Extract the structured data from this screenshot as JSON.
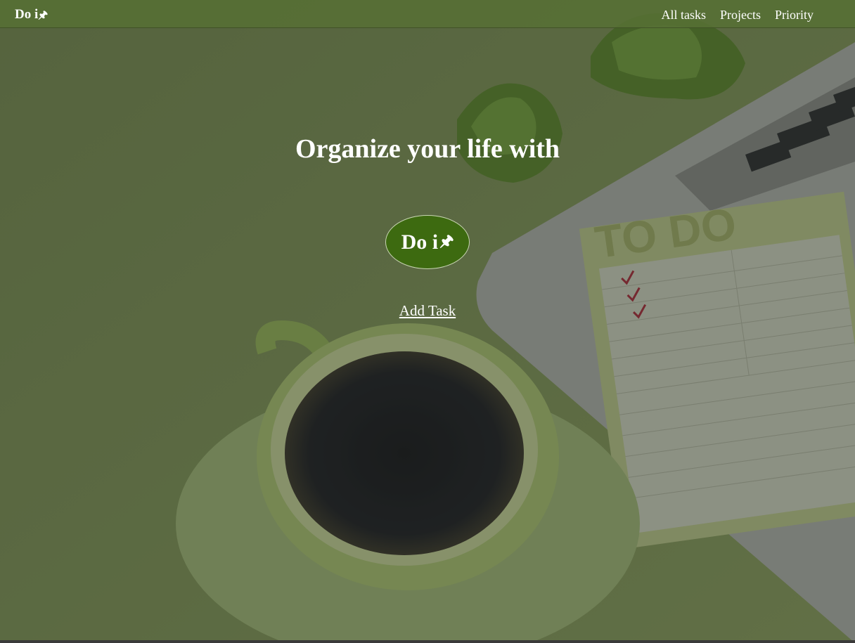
{
  "navbar": {
    "brand": "Do i",
    "brand_icon": "pushpin-icon",
    "links": [
      "All tasks",
      "Projects",
      "Priority"
    ]
  },
  "hero": {
    "title": "Organize your life with",
    "logo_text": "Do i",
    "logo_icon": "pushpin-icon",
    "add_task_label": "Add Task"
  },
  "background_image": {
    "notepad_heading": "TO DO"
  },
  "colors": {
    "navbar": "#567034",
    "logo_bg": "#3d6a10",
    "text": "#ffffff"
  }
}
